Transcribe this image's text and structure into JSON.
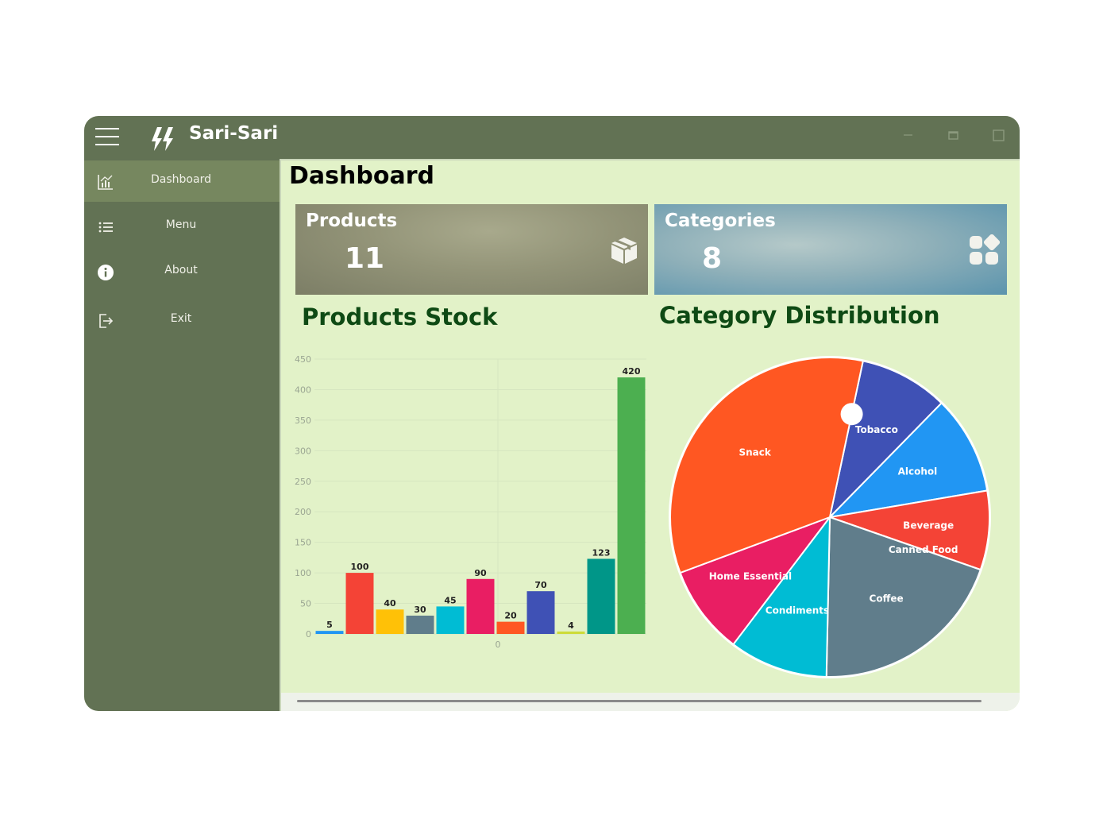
{
  "app": {
    "title": "Sari-Sari"
  },
  "window_controls": [
    "minimize-icon",
    "maximize-icon",
    "restore-icon"
  ],
  "sidebar": {
    "items": [
      {
        "label": "Dashboard",
        "icon": "chart-icon",
        "active": true
      },
      {
        "label": "Menu",
        "icon": "list-icon",
        "active": false
      },
      {
        "label": "About",
        "icon": "info-icon",
        "active": false
      },
      {
        "label": "Exit",
        "icon": "exit-icon",
        "active": false
      }
    ]
  },
  "main": {
    "title": "Dashboard",
    "cards": [
      {
        "label": "Products",
        "value": "11",
        "icon": "box-icon"
      },
      {
        "label": "Categories",
        "value": "8",
        "icon": "category-grid-icon"
      }
    ],
    "stock_title": "Products Stock",
    "distribution_title": "Category Distribution"
  },
  "colors": {
    "titlebar": "#627254",
    "sidebar": "#627254",
    "sidebar_active": "#76875f",
    "content_bg": "#e2f2c8",
    "heading_green": "#0e4a14"
  },
  "chart_data": [
    {
      "type": "bar",
      "title": "Products Stock",
      "ylim": [
        0,
        450
      ],
      "yticks": [
        0,
        50,
        100,
        150,
        200,
        250,
        300,
        350,
        400,
        450
      ],
      "xtick_label": "0",
      "values": [
        5,
        100,
        40,
        30,
        45,
        90,
        20,
        70,
        4,
        123,
        420
      ],
      "colors": [
        "#2196F3",
        "#F44336",
        "#FFC107",
        "#607D8B",
        "#00BCD4",
        "#E91E63",
        "#FF5722",
        "#3F51B5",
        "#CDDC39",
        "#009688",
        "#4CAF50"
      ]
    },
    {
      "type": "pie",
      "title": "Category Distribution",
      "slices": [
        {
          "label": "Tobacco",
          "value": 9.0,
          "color": "#3F51B5"
        },
        {
          "label": "Alcohol",
          "value": 10.0,
          "color": "#2196F3"
        },
        {
          "label": "Beverage",
          "value": 8.0,
          "color": "#F44336"
        },
        {
          "label": "Canned Food",
          "value": 0.01,
          "color": "#FF9800"
        },
        {
          "label": "Coffee",
          "value": 20.0,
          "color": "#607D8B"
        },
        {
          "label": "Condiments",
          "value": 10.0,
          "color": "#00BCD4"
        },
        {
          "label": "Home Essential",
          "value": 9.0,
          "color": "#E91E63"
        },
        {
          "label": "Snack",
          "value": 34.0,
          "color": "#FF5722"
        }
      ],
      "start_angle_deg": 12
    }
  ]
}
